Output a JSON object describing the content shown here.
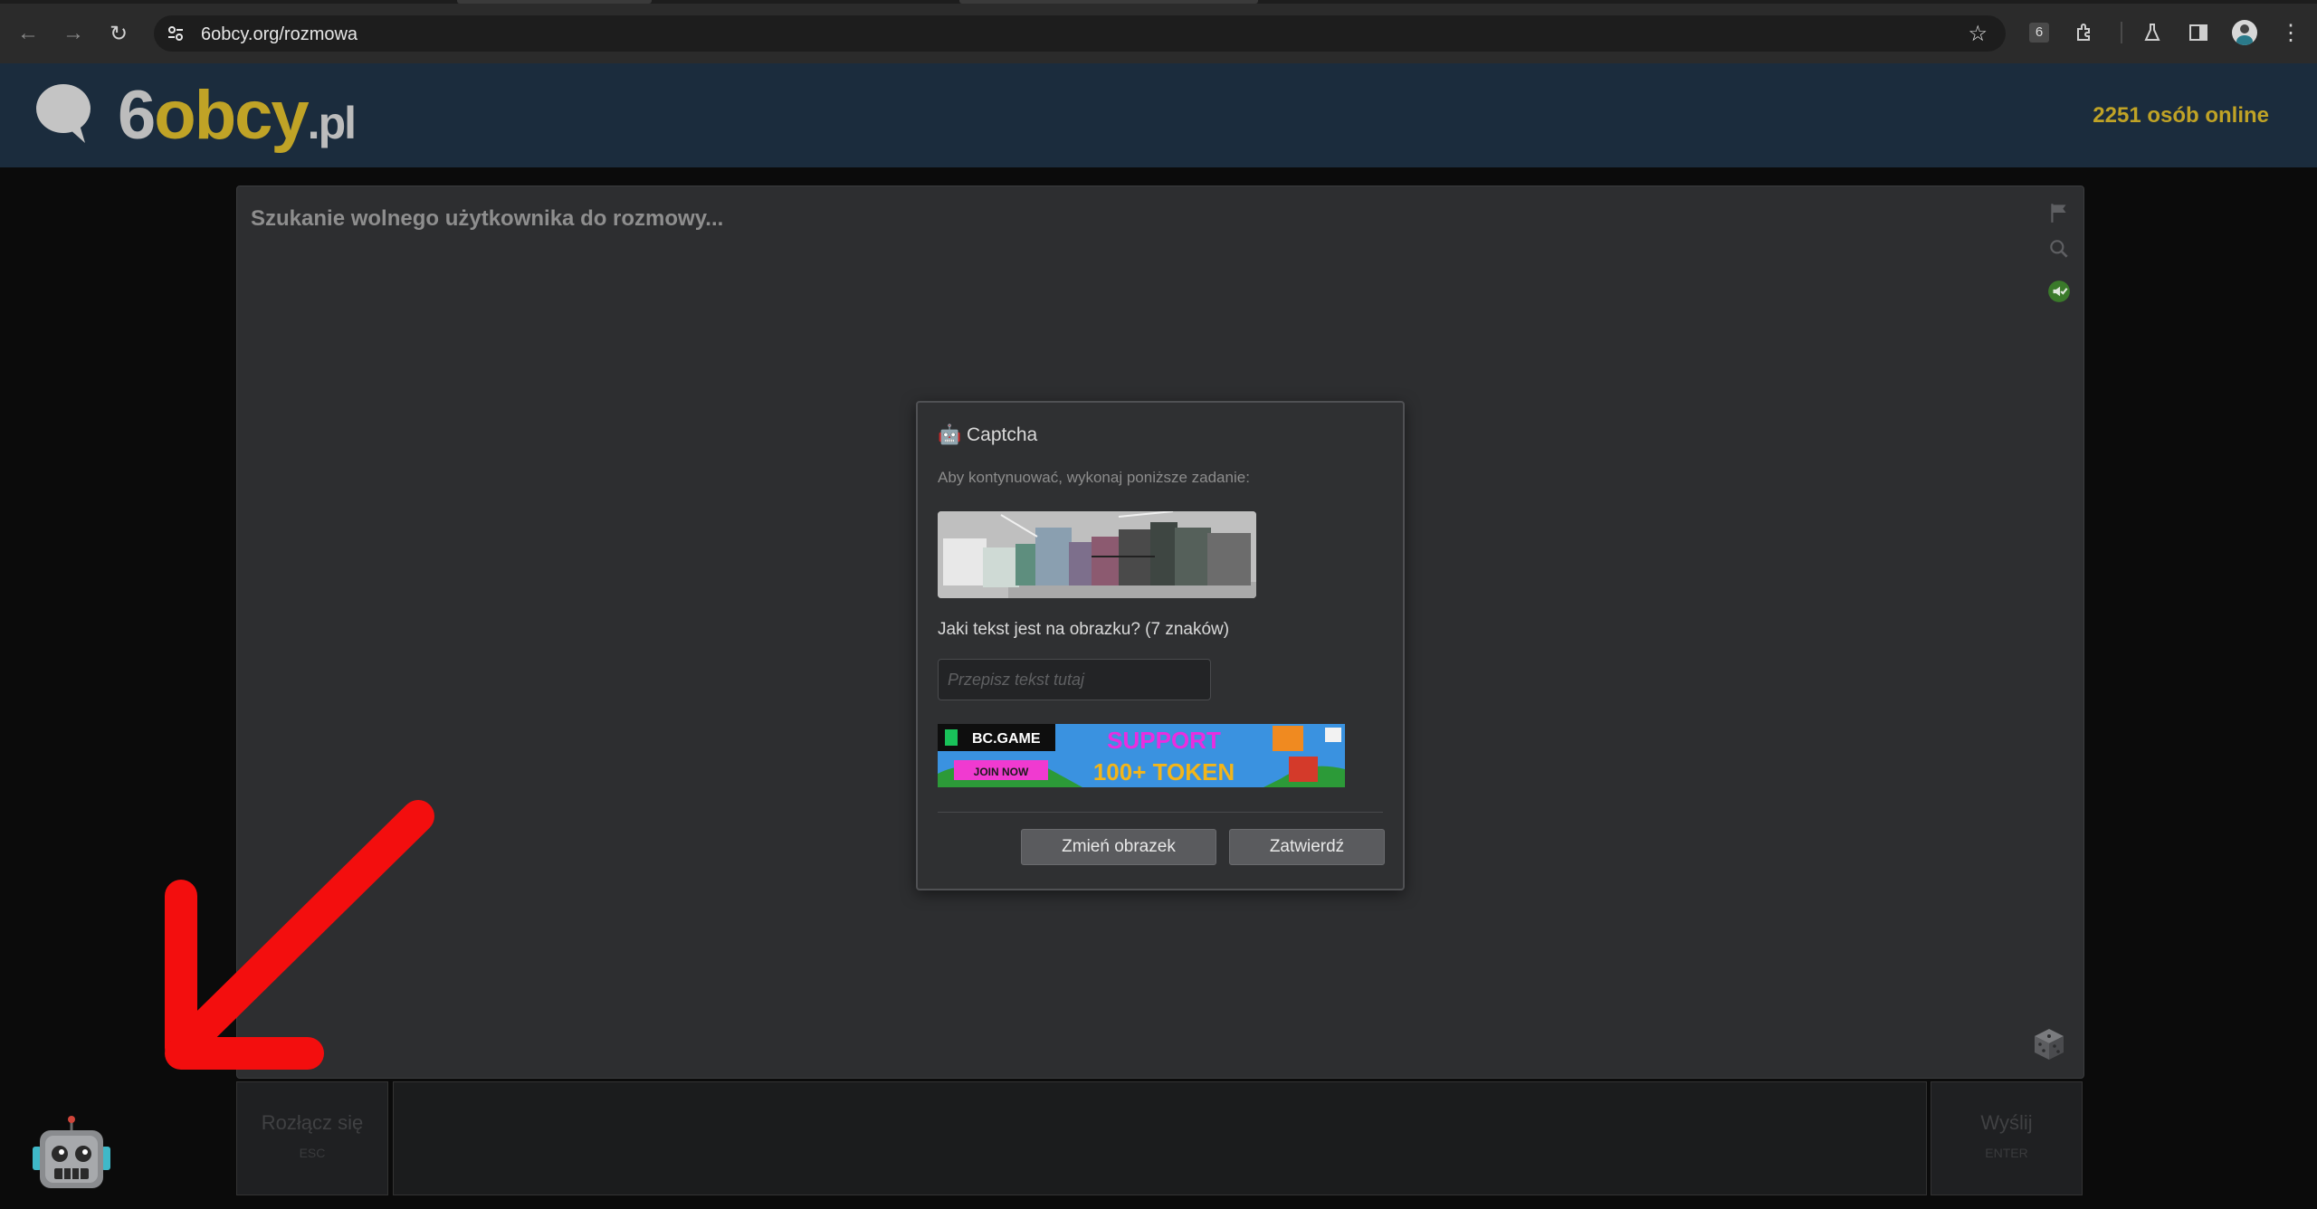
{
  "browser": {
    "url": "6obcy.org/rozmowa",
    "tune_icon": "tune-icon",
    "bookmark_icon": "star-icon",
    "extension_badge": "6",
    "back_icon": "arrow-left-icon",
    "forward_icon": "arrow-right-icon",
    "reload_icon": "reload-icon"
  },
  "header": {
    "logo_six": "6",
    "logo_obcy": "obcy",
    "logo_pl": ".pl",
    "online": "2251 osób online",
    "accent_color": "#c0a326"
  },
  "chat": {
    "status": "Szukanie wolnego użytkownika do rozmowy..."
  },
  "captcha": {
    "title": "🤖 Captcha",
    "subtitle": "Aby kontynuować, wykonaj poniższe zadanie:",
    "question": "Jaki tekst jest na obrazku? (7 znaków)",
    "placeholder": "Przepisz tekst tutaj",
    "change_button": "Zmień obrazek",
    "submit_button": "Zatwierdź"
  },
  "ad": {
    "brand": "BC.GAME",
    "cta": "JOIN NOW",
    "line1": "SUPPORT",
    "line2": "100+ TOKEN"
  },
  "bottom": {
    "disconnect_label": "Rozłącz się",
    "disconnect_key": "ESC",
    "send_label": "Wyślij",
    "send_key": "ENTER"
  }
}
